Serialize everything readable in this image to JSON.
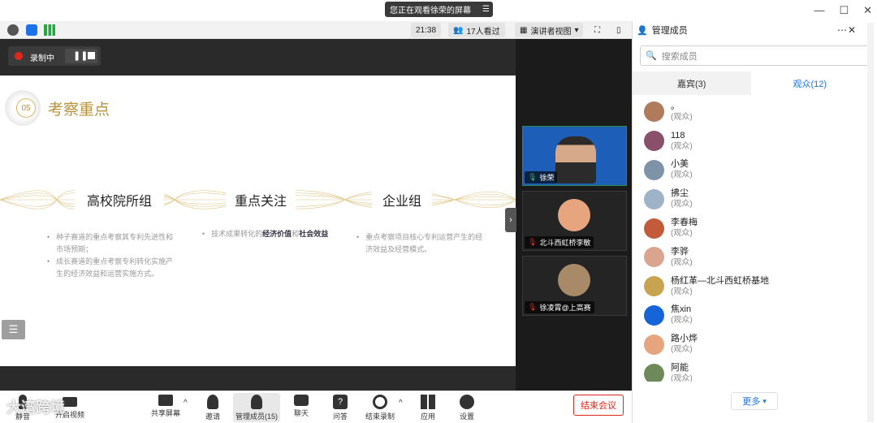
{
  "banner": {
    "text": "您正在观看徐荣的屏幕"
  },
  "infobar": {
    "time": "21:38",
    "viewers": "17人看过",
    "view_mode": "演讲者视图"
  },
  "recording": {
    "label": "录制中"
  },
  "slide": {
    "number": "05",
    "heading": "考察重点",
    "columns": [
      {
        "title": "高校院所组",
        "bullets": [
          "种子赛道的重点考察其专利先进性和市场预期；",
          "成长赛道的重点考察专利转化实施产生的经济效益和运营实施方式。"
        ]
      },
      {
        "title": "重点关注",
        "text_plain": "技术成果转化的",
        "text_bold1": "经济价值",
        "text_and": "和",
        "text_bold2": "社会效益"
      },
      {
        "title": "企业组",
        "bullets": [
          "重点考察项目核心专利运营产生的经济效益及经营模式。"
        ]
      }
    ]
  },
  "videos": [
    {
      "name": "徐荣"
    },
    {
      "name": "北斗西虹桥李敏"
    },
    {
      "name": "徐凌霄@上高赛"
    }
  ],
  "toolbar": {
    "mute": "静音",
    "video": "开启视频",
    "share": "共享屏幕",
    "invite": "邀请",
    "members": "管理成员(15)",
    "chat": "聊天",
    "qa": "问答",
    "end_record": "结束录制",
    "apps": "应用",
    "settings": "设置",
    "end_meeting": "结束会议"
  },
  "watermark": "大湾跨境",
  "panel": {
    "title": "管理成员",
    "search_placeholder": "搜索成员",
    "tabs": [
      "嘉宾(3)",
      "观众(12)"
    ],
    "members": [
      {
        "name": "。",
        "role": "(观众)",
        "color": "#b07a5c"
      },
      {
        "name": "118",
        "role": "(观众)",
        "color": "#8a4f6a"
      },
      {
        "name": "小美",
        "role": "(观众)",
        "color": "#7f93a8"
      },
      {
        "name": "拂尘",
        "role": "(观众)",
        "color": "#9fb3c8"
      },
      {
        "name": "李春梅",
        "role": "(观众)",
        "color": "#c35a3a"
      },
      {
        "name": "李骅",
        "role": "(观众)",
        "color": "#d9a58f"
      },
      {
        "name": "杨红革—北斗西虹桥基地",
        "role": "(观众)",
        "color": "#c8a451"
      },
      {
        "name": "焦xin",
        "role": "(观众)",
        "color": "#1565d8"
      },
      {
        "name": "路小烨",
        "role": "(观众)",
        "color": "#e7a57f"
      },
      {
        "name": "阿能",
        "role": "(观众)",
        "color": "#6f8a5a"
      }
    ],
    "more": "更多"
  },
  "colors": {
    "accent": "#1a73e8",
    "danger": "#e0281a",
    "gold": "#b8923a"
  }
}
